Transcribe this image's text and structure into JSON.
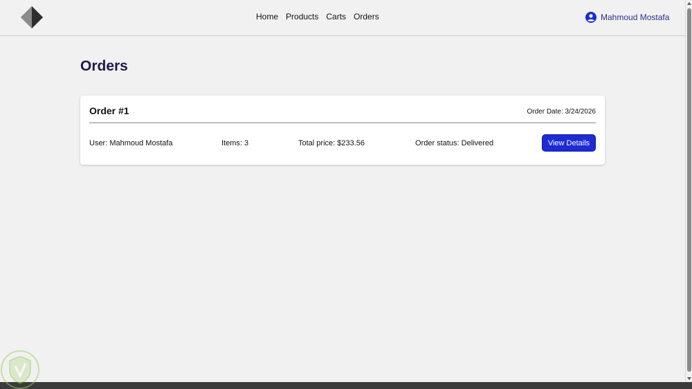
{
  "header": {
    "nav": [
      {
        "label": "Home"
      },
      {
        "label": "Products"
      },
      {
        "label": "Carts"
      },
      {
        "label": "Orders"
      }
    ],
    "user_name": "Mahmoud Mostafa"
  },
  "main": {
    "title": "Orders",
    "order": {
      "number": "Order #1",
      "date": "Order Date: 3/24/2026",
      "user": "User: Mahmoud Mostafa",
      "items": "Items: 3",
      "total_price": "Total price: $233.56",
      "status": "Order status: Delivered",
      "button_label": "View Details"
    }
  },
  "colors": {
    "accent": "#1d2bd6",
    "title": "#1e1b4b",
    "user_link": "#2a2f8f"
  },
  "icons": {
    "logo": "diamond-logo-icon",
    "user": "user-circle-icon",
    "watermark": "shield-watermark-icon"
  }
}
